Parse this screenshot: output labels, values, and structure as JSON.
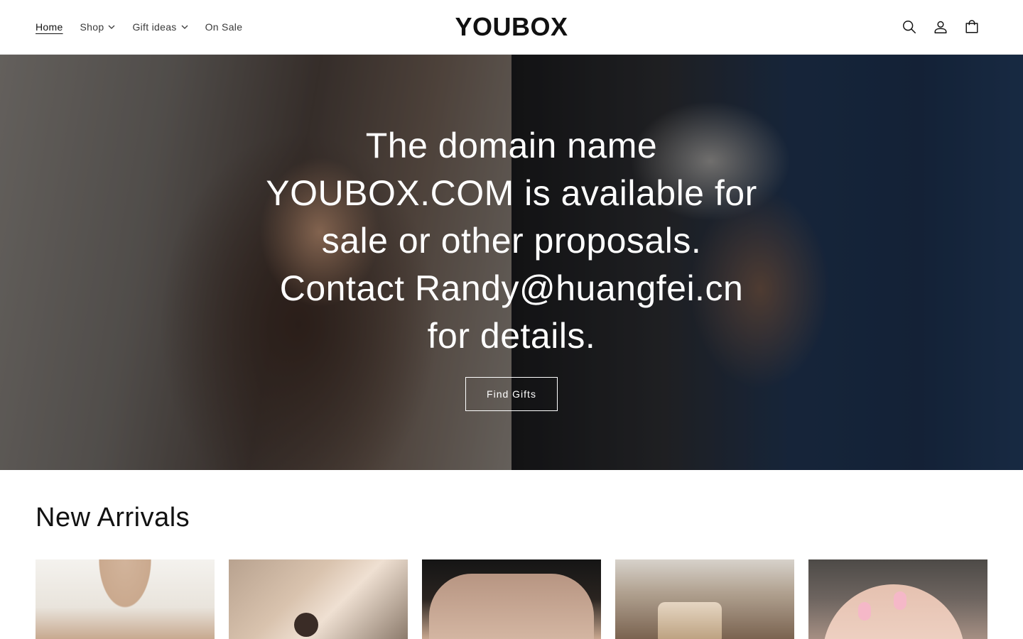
{
  "header": {
    "nav": [
      {
        "label": "Home",
        "active": true,
        "has_dropdown": false
      },
      {
        "label": "Shop",
        "active": false,
        "has_dropdown": true
      },
      {
        "label": "Gift ideas",
        "active": false,
        "has_dropdown": true
      },
      {
        "label": "On Sale",
        "active": false,
        "has_dropdown": false
      }
    ],
    "logo": "YOUBOX",
    "icons": [
      "search-icon",
      "account-icon",
      "cart-icon"
    ]
  },
  "hero": {
    "heading": "The domain name YOUBOX.COM is available for sale or other proposals. Contact Randy@huangfei.cn for details.",
    "button_label": "Find Gifts"
  },
  "new_arrivals": {
    "title": "New Arrivals",
    "products": [
      {
        "image": "necklace-product-image"
      },
      {
        "image": "ring-product-image"
      },
      {
        "image": "hand-ring-product-image"
      },
      {
        "image": "bracelet-product-image"
      },
      {
        "image": "nails-product-image"
      }
    ]
  },
  "colors": {
    "text": "#121212",
    "header_border": "#e6e6e6",
    "hero_text": "#ffffff"
  }
}
